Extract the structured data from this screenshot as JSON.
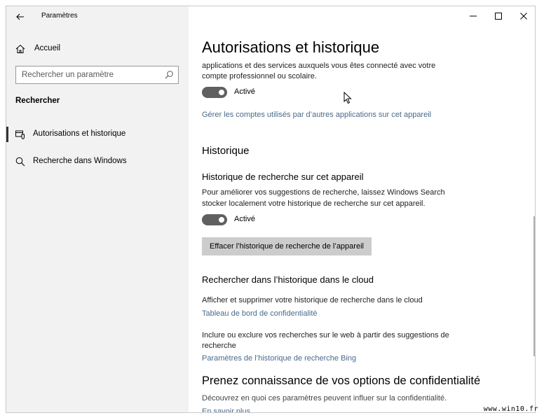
{
  "window": {
    "app_title": "Paramètres",
    "icons": {
      "back": "back-arrow-icon",
      "minimize": "minimize-icon",
      "maximize": "maximize-icon",
      "close": "close-icon"
    }
  },
  "sidebar": {
    "home_label": "Accueil",
    "search_placeholder": "Rechercher un paramètre",
    "section_title": "Rechercher",
    "items": [
      {
        "label": "Autorisations et historique",
        "icon": "permissions-icon",
        "active": true
      },
      {
        "label": "Recherche dans Windows",
        "icon": "search-icon",
        "active": false
      }
    ]
  },
  "main": {
    "title": "Autorisations et historique",
    "intro_line1": "applications et des services auxquels vous êtes connecté avec votre",
    "intro_line2": "compte professionnel ou scolaire.",
    "toggle1_state": "Activé",
    "manage_accounts_link": "Gérer les comptes utilisés par d’autres applications sur cet appareil",
    "history_heading": "Historique",
    "device_history_heading": "Historique de recherche sur cet appareil",
    "device_history_desc1": "Pour améliorer vos suggestions de recherche, laissez Windows Search",
    "device_history_desc2": "stocker localement votre historique de recherche sur cet appareil.",
    "toggle2_state": "Activé",
    "clear_history_button": "Effacer l’historique de recherche de l’appareil",
    "cloud_heading": "Rechercher dans l’historique dans le cloud",
    "cloud_desc": "Afficher et supprimer votre historique de recherche dans le cloud",
    "privacy_dashboard_link": "Tableau de bord de confidentialité",
    "bing_desc1": "Inclure ou exclure vos recherches sur le web à partir des suggestions de",
    "bing_desc2": "recherche",
    "bing_link": "Paramètres de l’historique de recherche Bing",
    "privacy_heading": "Prenez connaissance de vos options de confidentialité",
    "privacy_desc": "Découvrez en quoi ces paramètres peuvent influer sur la confidentialité.",
    "learn_more_link": "En savoir plus"
  },
  "watermark": "www.win10.fr"
}
